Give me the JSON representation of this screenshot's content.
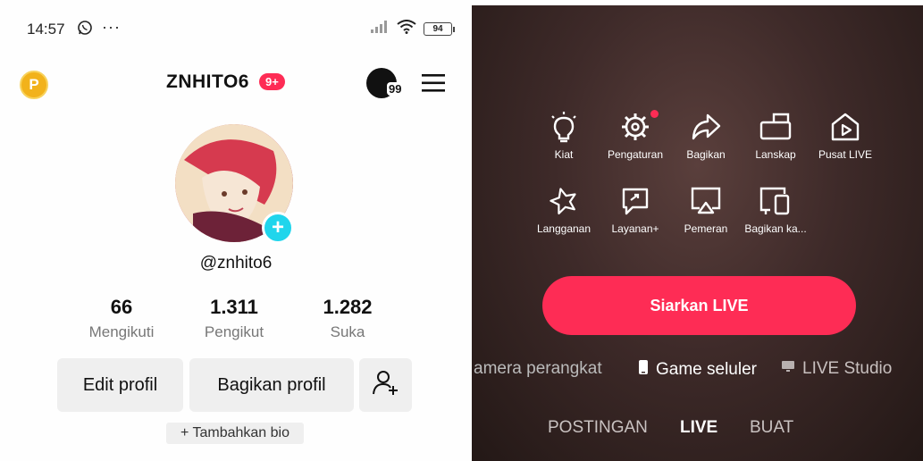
{
  "status_bar": {
    "time": "14:57",
    "battery": "94"
  },
  "profile": {
    "coin_label": "P",
    "username": "ZNHITO6",
    "notif_badge": "9+",
    "story_count": "99",
    "handle": "@znhito6",
    "stats": [
      {
        "value": "66",
        "label": "Mengikuti"
      },
      {
        "value": "1.311",
        "label": "Pengikut"
      },
      {
        "value": "1.282",
        "label": "Suka"
      }
    ],
    "buttons": {
      "edit": "Edit profil",
      "share": "Bagikan profil"
    },
    "bio_button": "+ Tambahkan bio"
  },
  "live_panel": {
    "options": [
      {
        "label": "Kiat",
        "icon": "lightbulb-icon"
      },
      {
        "label": "Pengaturan",
        "icon": "gear-icon"
      },
      {
        "label": "Bagikan",
        "icon": "share-arrow-icon"
      },
      {
        "label": "Lanskap",
        "icon": "landscape-icon"
      },
      {
        "label": "Pusat LIVE",
        "icon": "live-center-icon"
      },
      {
        "label": "Langganan",
        "icon": "subscription-star-icon"
      },
      {
        "label": "Layanan+",
        "icon": "service-chat-icon"
      },
      {
        "label": "Pemeran",
        "icon": "cast-screen-icon"
      },
      {
        "label": "Bagikan ka...",
        "icon": "devices-icon"
      }
    ],
    "go_live_button": "Siarkan LIVE",
    "sources": [
      "amera perangkat",
      "Game seluler",
      "LIVE Studio"
    ],
    "tabs": [
      "POSTINGAN",
      "LIVE",
      "BUAT"
    ],
    "active_tab": "LIVE",
    "colors": {
      "accent": "#fe2c55",
      "avatar_plus": "#20d5ec",
      "coin": "#f2b21b"
    }
  }
}
